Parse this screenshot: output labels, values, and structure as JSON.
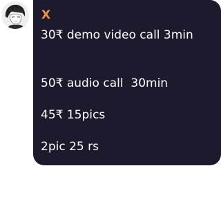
{
  "message": {
    "avatar_icon": "profile-sketch-avatar-icon",
    "sender_name": "X",
    "sender_color": "#f0924a",
    "bubble_color": "#1c1a2c",
    "lines": [
      "30₹ demo video call 3min",
      "50₹ audio call  30min",
      "45₹ 15pics",
      "2pic 25 rs"
    ]
  }
}
